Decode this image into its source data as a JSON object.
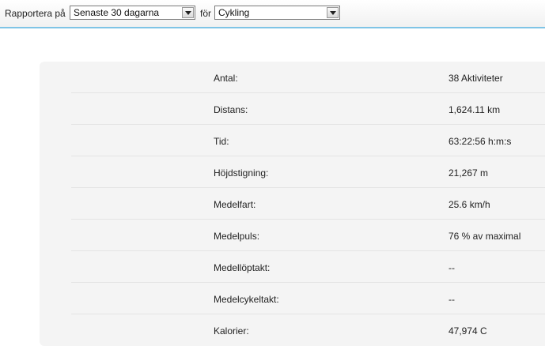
{
  "toolbar": {
    "report_label": "Rapportera på",
    "period_value": "Senaste 30 dagarna",
    "for_label": "för",
    "sport_value": "Cykling"
  },
  "stats": [
    {
      "label": "Antal:",
      "value": "38 Aktiviteter"
    },
    {
      "label": "Distans:",
      "value": "1,624.11 km"
    },
    {
      "label": "Tid:",
      "value": "63:22:56 h:m:s"
    },
    {
      "label": "Höjdstigning:",
      "value": "21,267 m"
    },
    {
      "label": "Medelfart:",
      "value": "25.6 km/h"
    },
    {
      "label": "Medelpuls:",
      "value": "76 % av maximal"
    },
    {
      "label": "Medellöptakt:",
      "value": "--"
    },
    {
      "label": "Medelcykeltakt:",
      "value": "--"
    },
    {
      "label": "Kalorier:",
      "value": "47,974 C"
    }
  ]
}
